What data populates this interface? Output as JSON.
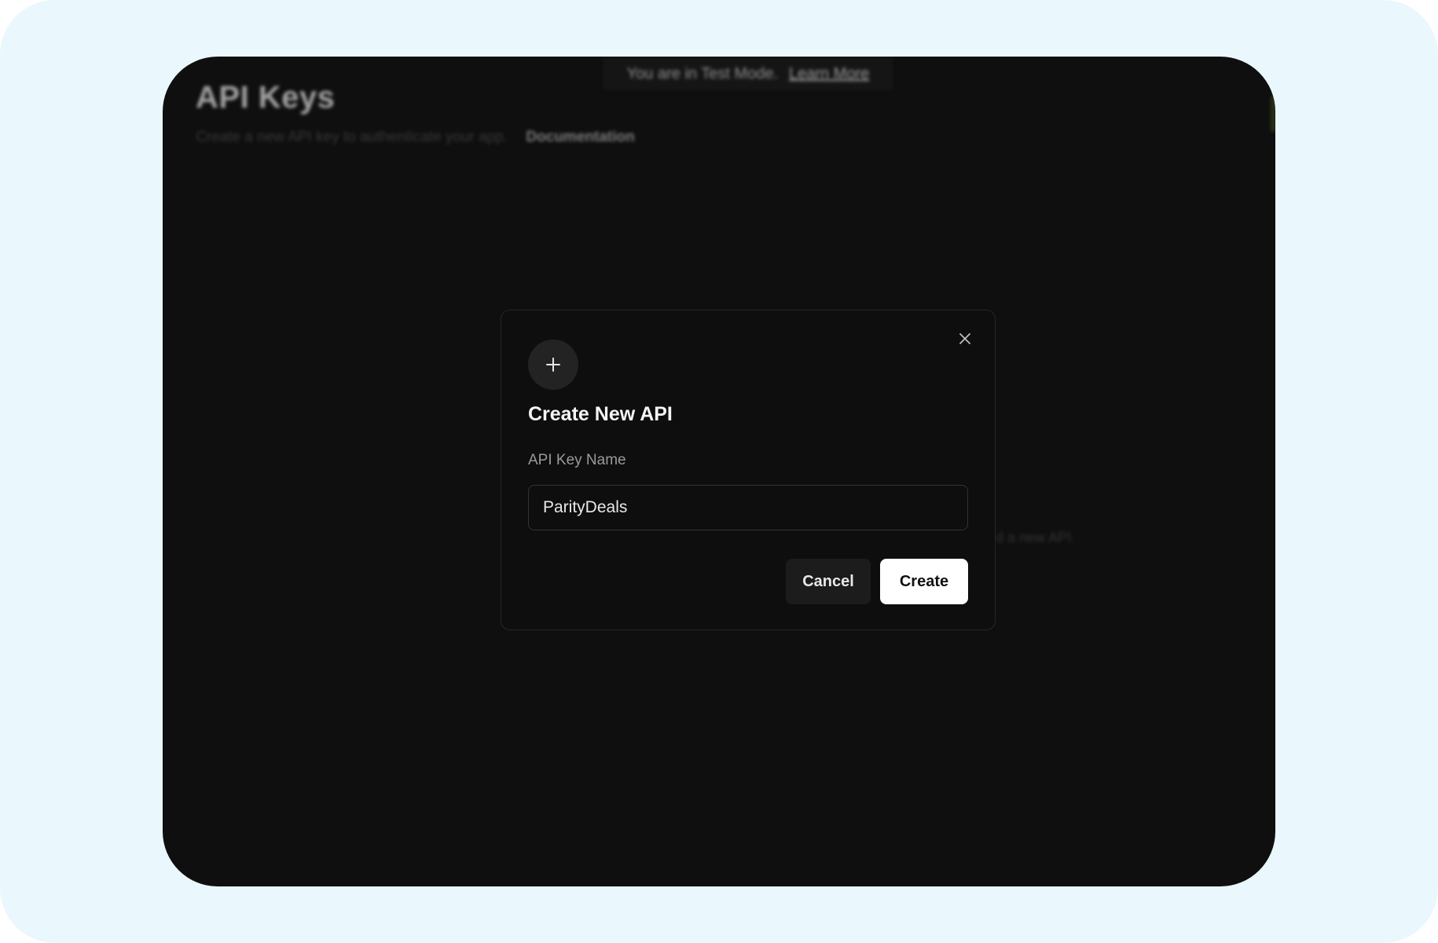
{
  "banner": {
    "message": "You are in Test Mode.",
    "link_label": "Learn More"
  },
  "page": {
    "title": "API Keys",
    "subtitle": "Create a new API key to authenticate your app.",
    "doc_link": "Documentation",
    "empty_hint": "d a new API."
  },
  "modal": {
    "icon": "plus-icon",
    "close_icon": "close-icon",
    "title": "Create New API",
    "field_label": "API Key Name",
    "field_value": "ParityDeals",
    "cancel_label": "Cancel",
    "create_label": "Create"
  },
  "colors": {
    "page_background": "#eaf7fd",
    "app_background": "#0f0f0f",
    "primary_button": "#ffffff",
    "secondary_button": "#1c1c1c"
  }
}
